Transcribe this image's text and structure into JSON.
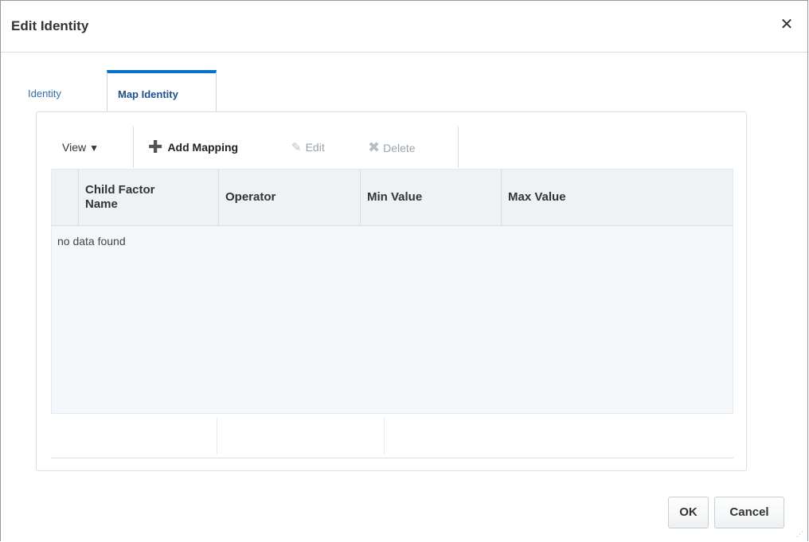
{
  "dialog": {
    "title": "Edit Identity",
    "close_glyph": "✕"
  },
  "tabs": [
    {
      "label": "Identity",
      "selected": false
    },
    {
      "label": "Map Identity",
      "selected": true
    }
  ],
  "toolbar": {
    "view_label": "View",
    "view_caret": "▼",
    "add_label": "Add Mapping",
    "add_icon": "plus-icon",
    "edit_label": "Edit",
    "edit_icon": "pencil-icon",
    "delete_label": "Delete",
    "delete_icon": "x-icon"
  },
  "table": {
    "columns": [
      "Child Factor Name",
      "Operator",
      "Min Value",
      "Max Value"
    ],
    "empty_text": "no data found",
    "rows": []
  },
  "buttons": {
    "ok_label": "OK",
    "cancel_label": "Cancel"
  },
  "colors": {
    "selected_tab_accent": "#0572ce",
    "link_blue": "#2f6ea8",
    "disabled_text": "#9aa4ab"
  }
}
